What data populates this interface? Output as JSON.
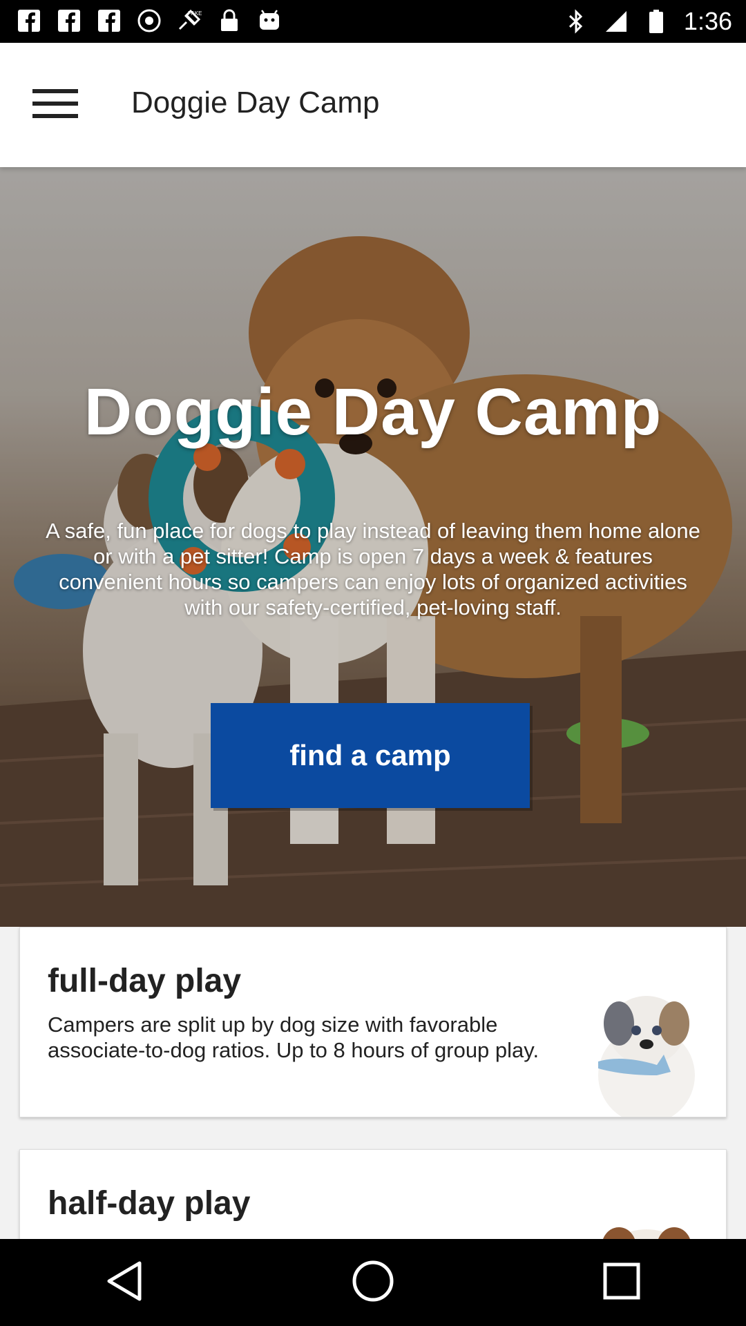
{
  "status_bar": {
    "time": "1:36",
    "left_icons": [
      "facebook-icon",
      "facebook-icon",
      "facebook-icon",
      "disc-icon",
      "fake-gps-icon",
      "lock-icon",
      "android-icon"
    ],
    "right_icons": [
      "bluetooth-icon",
      "signal-icon",
      "battery-icon"
    ]
  },
  "app_bar": {
    "title": "Doggie Day Camp",
    "menu_icon": "hamburger-menu-icon"
  },
  "hero": {
    "title": "Doggie Day Camp",
    "description": "A safe, fun place for dogs to play instead of leaving them home alone or with a pet sitter! Camp is open 7 days a week & features convenient hours so campers can enjoy lots of organized activities with our safety-certified, pet-loving staff.",
    "cta_label": "find a camp",
    "cta_color": "#0b4aa0"
  },
  "cards": [
    {
      "title": "full-day play",
      "description": "Campers are split up by dog size with favorable associate-to-dog ratios. Up to 8 hours of group play."
    },
    {
      "title": "half-day play",
      "description": ""
    }
  ],
  "nav_bar": {
    "buttons": [
      "back-icon",
      "home-icon",
      "recents-icon"
    ]
  }
}
